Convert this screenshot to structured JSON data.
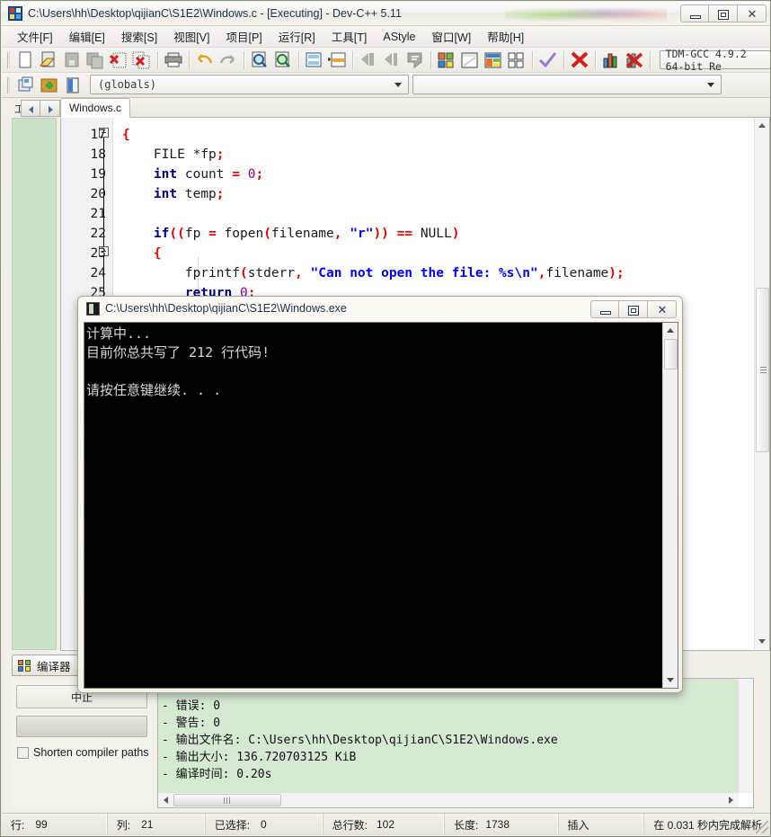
{
  "window": {
    "title": "C:\\Users\\hh\\Desktop\\qijianC\\S1E2\\Windows.c - [Executing] - Dev-C++ 5.11",
    "minimize_label": "–",
    "maximize_label": "□",
    "close_label": "✕"
  },
  "menu": {
    "items": [
      "文件[F]",
      "编辑[E]",
      "搜索[S]",
      "视图[V]",
      "项目[P]",
      "运行[R]",
      "工具[T]",
      "AStyle",
      "窗口[W]",
      "帮助[H]"
    ]
  },
  "toolbar": {
    "compiler_combo": "TDM-GCC 4.9.2 64-bit Re",
    "scope_combo": "(globals)",
    "secondary_combo": ""
  },
  "left_panel": {
    "label": "工"
  },
  "editor": {
    "tab_label": "Windows.c",
    "lines": [
      {
        "num": "17",
        "fold": true,
        "text": "{"
      },
      {
        "num": "18",
        "fold": false,
        "text": "    FILE *fp;"
      },
      {
        "num": "19",
        "fold": false,
        "text": "    int count = 0;"
      },
      {
        "num": "20",
        "fold": false,
        "text": "    int temp;"
      },
      {
        "num": "21",
        "fold": false,
        "text": ""
      },
      {
        "num": "22",
        "fold": false,
        "text": "    if((fp = fopen(filename, \"r\")) == NULL)"
      },
      {
        "num": "23",
        "fold": true,
        "text": "    {"
      },
      {
        "num": "24",
        "fold": false,
        "text": "        fprintf(stderr, \"Can not open the file: %s\\n\",filename);"
      },
      {
        "num": "25",
        "fold": false,
        "text": "        return 0;"
      }
    ]
  },
  "console": {
    "title": "C:\\Users\\hh\\Desktop\\qijianC\\S1E2\\Windows.exe",
    "output": "计算中...\n目前你总共写了 212 行代码!\n\n请按任意键继续. . .",
    "minimize_label": "–",
    "restore_label": "□",
    "close_label": "✕"
  },
  "compiler_panel": {
    "tab_label": "编译器",
    "box1_text": "中止",
    "checkbox_label": "Shorten compiler paths",
    "log": "--------\n- 错误: 0\n- 警告: 0\n- 输出文件名: C:\\Users\\hh\\Desktop\\qijianC\\S1E2\\Windows.exe\n- 输出大小: 136.720703125 KiB\n- 编译时间: 0.20s"
  },
  "status_bar": {
    "cells": [
      {
        "label": "行:",
        "value": "99"
      },
      {
        "label": "列:",
        "value": "21"
      },
      {
        "label": "已选择:",
        "value": "0"
      },
      {
        "label": "总行数:",
        "value": "102"
      },
      {
        "label": "长度:",
        "value": "1738"
      },
      {
        "label": "插入",
        "value": ""
      },
      {
        "label": "在 0.031 秒内完成解析",
        "value": ""
      }
    ]
  },
  "colors": {
    "log_bg": "#d6ead3",
    "panel_bg": "#cde2cb",
    "keyword": "#000080",
    "string": "#0000ee",
    "punct": "#e00000",
    "number": "#880088"
  }
}
